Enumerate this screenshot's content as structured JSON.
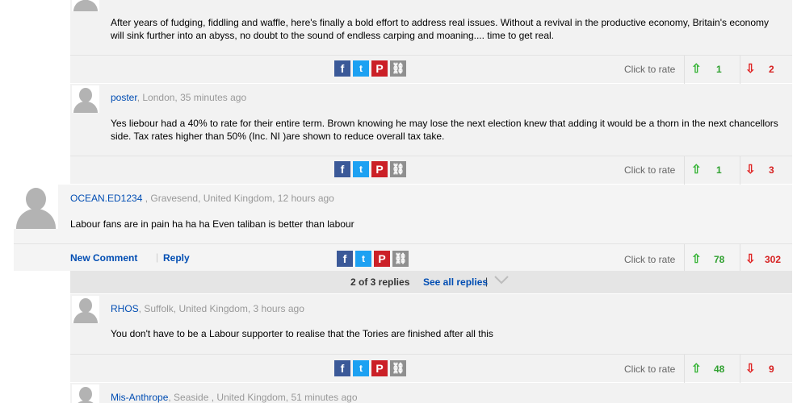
{
  "comments": [
    {
      "text": "After years of fudging, fiddling and waffle, here's finally a bold effort to address real issues. Without a revival in the productive economy, Britain's economy will sink further into an abyss, no doubt to the sound of endless carping and moaning.... time to get real.",
      "rate_label": "Click to rate",
      "up": "1",
      "down": "2"
    },
    {
      "username": "poster",
      "meta": ", London, 35 minutes ago",
      "text": "Yes liebour had a 40% to rate for their entire term. Brown knowing he may lose the next election knew that adding it would be a thorn in the next chancellors side. Tax rates higher than 50% (Inc. NI )are shown to reduce overall tax take.",
      "rate_label": "Click to rate",
      "up": "1",
      "down": "3"
    },
    {
      "username": "OCEAN.ED1234",
      "meta": " , Gravesend, United Kingdom, 12 hours ago",
      "text": "Labour fans are in pain ha ha ha Even taliban is better than labour",
      "new_comment": "New Comment",
      "reply": "Reply",
      "rate_label": "Click to rate",
      "up": "78",
      "down": "302"
    },
    {
      "username": "RHOS",
      "meta": ", Suffolk, United Kingdom, 3 hours ago",
      "text": "You don't have to be a Labour supporter to realise that the Tories are finished after all this",
      "rate_label": "Click to rate",
      "up": "48",
      "down": "9"
    },
    {
      "username": "Mis-Anthrope",
      "meta": ", Seaside , United Kingdom, 51 minutes ago"
    }
  ],
  "replies_bar": {
    "count": "2 of 3 replies",
    "see_all": "See all replies"
  },
  "icons": {
    "facebook": "f",
    "twitter": "t",
    "pinterest": "P",
    "link": "⛓",
    "up": "⇧",
    "down": "⇩",
    "separator": "|"
  },
  "colors": {
    "username": "#004db3",
    "up": "#2fa02f",
    "down": "#d61f1f"
  }
}
